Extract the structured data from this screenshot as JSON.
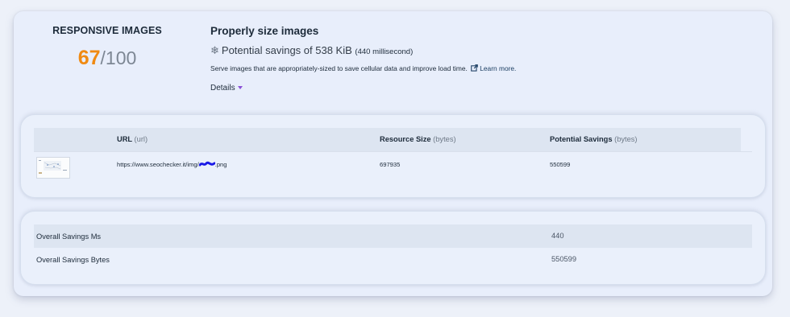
{
  "score": {
    "title": "RESPONSIVE IMAGES",
    "value": "67",
    "max": "/100",
    "value_color": "#f08a12"
  },
  "audit": {
    "title": "Properly size images",
    "savings_icon": "snowflake-icon",
    "savings_text": "Potential savings of 538 KiB",
    "savings_ms": "(440 millisecond)",
    "description": "Serve images that are appropriately-sized to save cellular data and improve load time.",
    "learn_icon": "external-link-icon",
    "learn_more": "Learn more.",
    "details_label": "Details",
    "details_icon": "caret-down-icon"
  },
  "table": {
    "columns": [
      {
        "label": "URL",
        "sub": "(url)"
      },
      {
        "label": "Resource Size",
        "sub": "(bytes)"
      },
      {
        "label": "Potential Savings",
        "sub": "(bytes)"
      }
    ],
    "rows": [
      {
        "url_prefix": "https://www.seochecker.it/img/",
        "url_suffix": ".png",
        "resource_size": "697935",
        "potential_savings": "550599"
      }
    ]
  },
  "summary": {
    "rows": [
      {
        "label": "Overall Savings Ms",
        "value": "440"
      },
      {
        "label": "Overall Savings Bytes",
        "value": "550599"
      }
    ]
  }
}
